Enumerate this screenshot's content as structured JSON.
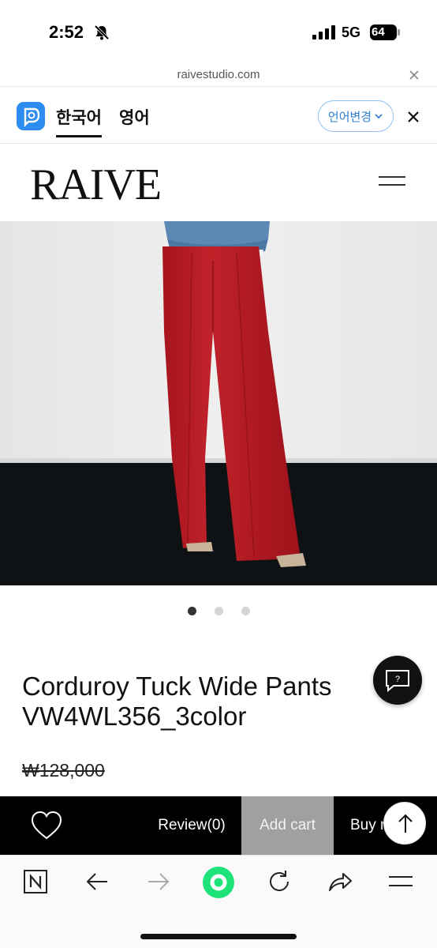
{
  "status_bar": {
    "time": "2:52",
    "network": "5G",
    "battery": "64"
  },
  "browser": {
    "url": "raivestudio.com"
  },
  "translate_bar": {
    "tabs": [
      {
        "label": "한국어",
        "active": true
      },
      {
        "label": "영어",
        "active": false
      }
    ],
    "change_language_label": "언어변경"
  },
  "site": {
    "brand": "RAIVE"
  },
  "carousel": {
    "total_slides": 3,
    "active_index": 0
  },
  "product": {
    "name_line1": "Corduroy Tuck Wide Pants",
    "name_line2": "VW4WL356_3color",
    "original_price": "₩128,000",
    "main_color": "#b31b24"
  },
  "action_bar": {
    "review_label": "Review(0)",
    "add_cart_label": "Add cart",
    "buy_label": "Buy now"
  },
  "toolbar": {
    "icons": [
      "naver-n-icon",
      "back-arrow-icon",
      "forward-arrow-icon",
      "green-home-dot-icon",
      "reload-icon",
      "share-icon",
      "menu-icon"
    ]
  }
}
